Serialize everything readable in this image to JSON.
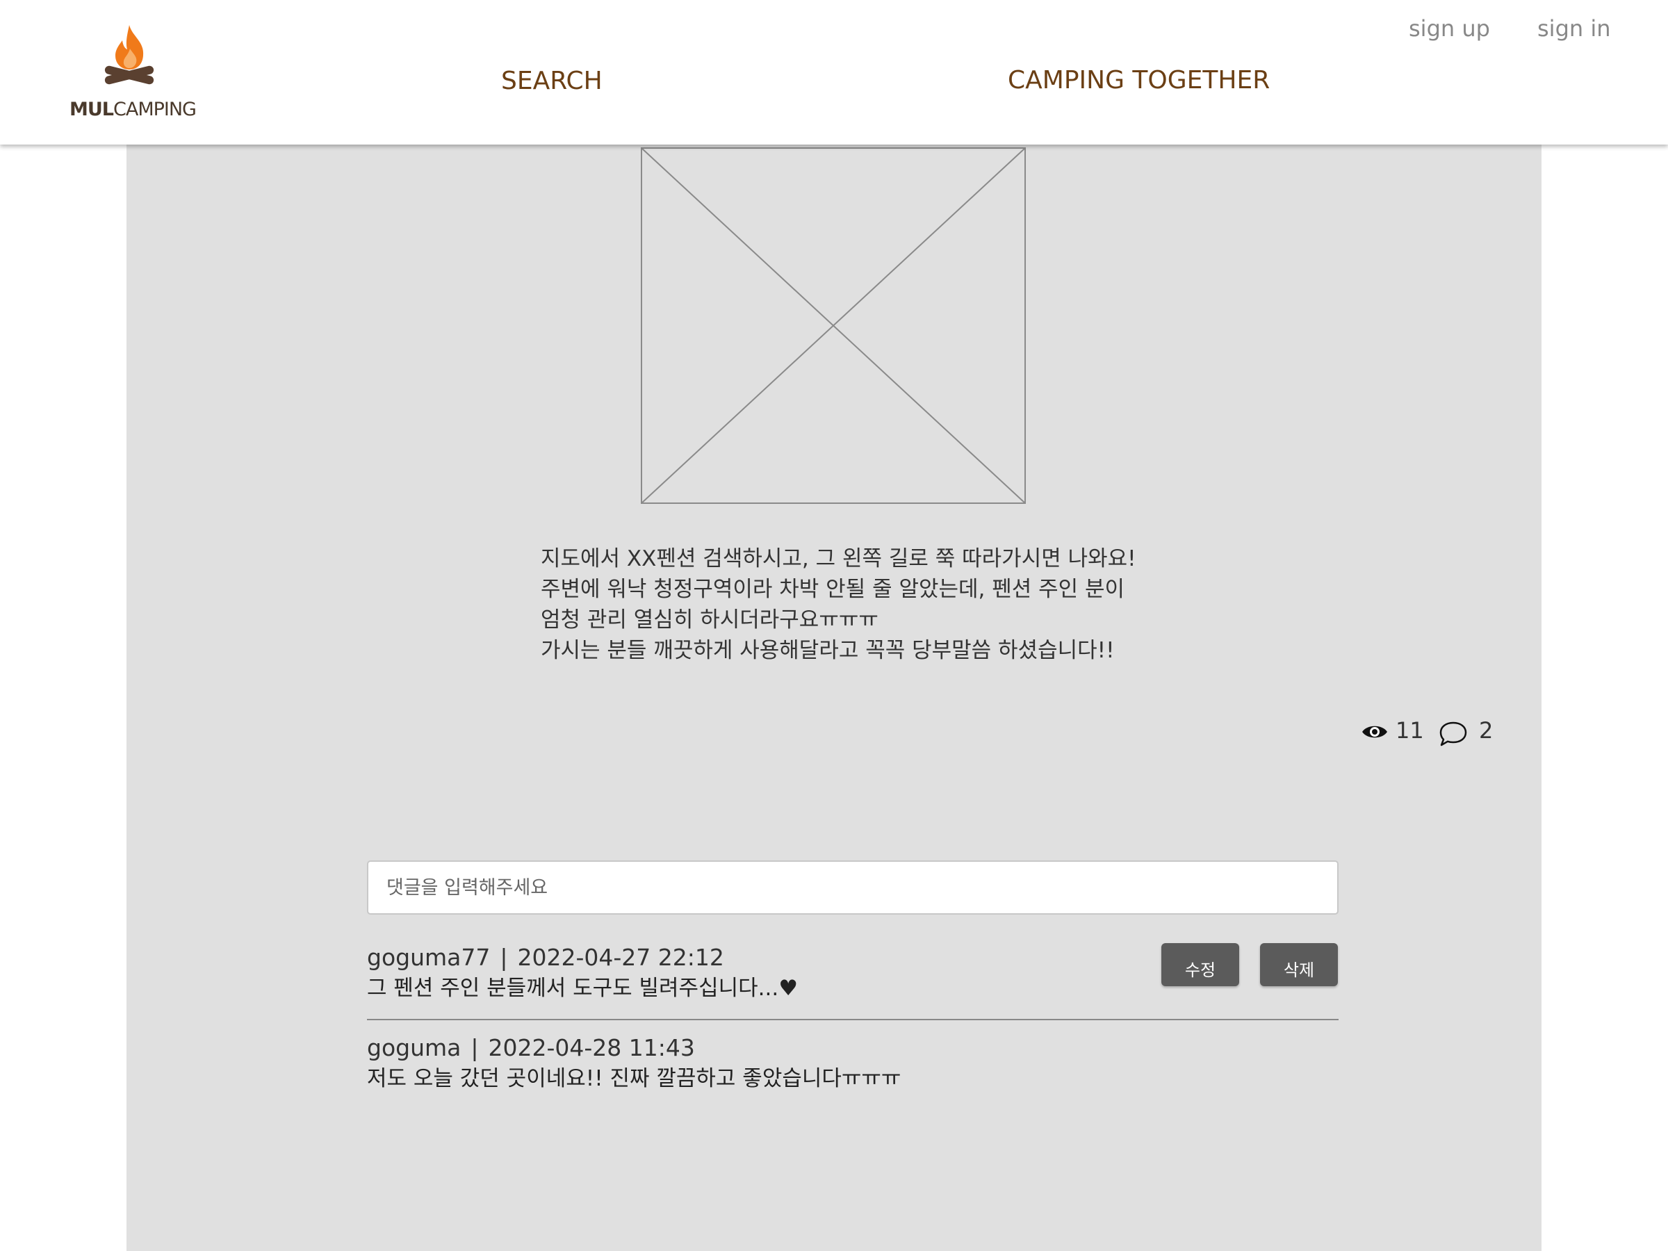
{
  "header": {
    "logo": {
      "bold": "MUL",
      "light": "CAMPING"
    },
    "nav": {
      "search": "SEARCH",
      "camping_together": "CAMPING TOGETHER"
    },
    "auth": {
      "sign_up": "sign up",
      "sign_in": "sign in"
    }
  },
  "post": {
    "image": {
      "icon": "image-placeholder-icon"
    },
    "text_lines": [
      " 지도에서 XX펜션 검색하시고, 그 왼쪽 길로 쭉 따라가시면 나와요!",
      "주변에 워낙 청정구역이라 차박 안될 줄 알았는데, 펜션 주인 분이",
      "엄청 관리 열심히 하시더라구요ㅠㅠㅠ",
      "가시는 분들 깨끗하게 사용해달라고 꼭꼭 당부말씀 하셨습니다!!"
    ],
    "stats": {
      "views": "11",
      "comments": "2",
      "view_icon": "eye-icon",
      "comment_icon": "speech-bubble-icon"
    }
  },
  "comment_input": {
    "placeholder": "댓글을 입력해주세요",
    "value": ""
  },
  "comments": [
    {
      "author": "goguma77",
      "separator": "|",
      "datetime": "2022-04-27 22:12",
      "body": "그 펜션 주인 분들께서 도구도 빌려주십니다...♥",
      "edit_label": "수정",
      "delete_label": "삭제"
    },
    {
      "author": "goguma",
      "separator": "|",
      "datetime": "2022-04-28 11:43",
      "body": "저도 오늘 갔던 곳이네요!! 진짜 깔끔하고 좋았습니다ㅠㅠㅠ"
    }
  ],
  "colors": {
    "nav_text": "#6b3f14",
    "auth_text": "#888888",
    "panel_bg": "#e0e0e0",
    "button_bg": "#5b5b5b",
    "flame_orange": "#f07a1a",
    "log_brown": "#5a4030"
  }
}
